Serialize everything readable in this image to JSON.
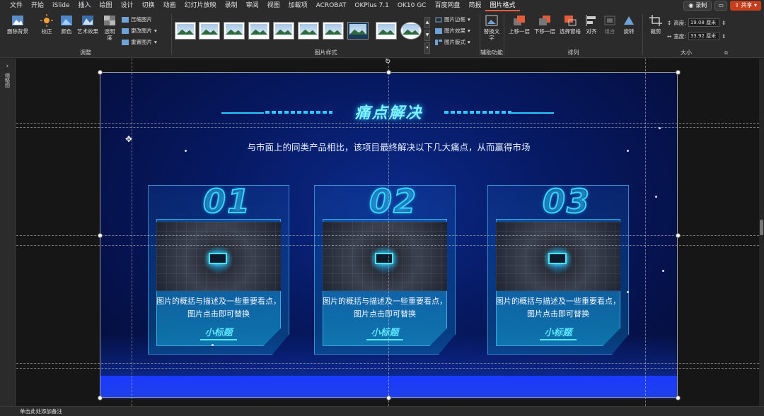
{
  "menu": {
    "items": [
      "文件",
      "开始",
      "iSlide",
      "插入",
      "绘图",
      "设计",
      "切换",
      "动画",
      "幻灯片放映",
      "录制",
      "审阅",
      "视图",
      "加载项",
      "ACROBAT",
      "OKPlus 7.1",
      "OK10 GC",
      "百度网盘",
      "简报",
      "图片格式"
    ],
    "active_index": 18,
    "record_label": "录制",
    "share_label": "共享"
  },
  "ribbon": {
    "adjust": {
      "group_label": "调整",
      "remove_bg": "删除背景",
      "correct": "校正",
      "color": "颜色",
      "art_effects": "艺术效果",
      "transparency": "透明度",
      "compress": "压缩图片",
      "change": "更改图片",
      "reset": "重置图片"
    },
    "styles": {
      "group_label": "图片样式",
      "border": "图片边框",
      "effects": "图片效果",
      "layout": "图片版式"
    },
    "accessibility": {
      "group_label": "辅助功能",
      "alt_text": "替换文字"
    },
    "arrange": {
      "group_label": "排列",
      "bring_forward": "上移一层",
      "send_backward": "下移一层",
      "selection_pane": "选择窗格",
      "align": "对齐",
      "group": "组合",
      "rotate": "旋转"
    },
    "size": {
      "group_label": "大小",
      "crop": "裁剪",
      "height_label": "高度:",
      "height_value": "19.08 厘米",
      "width_label": "宽度:",
      "width_value": "33.92 厘米"
    }
  },
  "left_pane": {
    "label": "缩略图"
  },
  "status": {
    "notes_hint": "单击此处添加备注"
  },
  "slide": {
    "title": "痛点解决",
    "subtitle": "与市面上的同类产品相比，该项目最终解决以下几大痛点，从而赢得市场",
    "cards": [
      {
        "num": "01",
        "desc": "图片的概括与描述及一些重要看点，图片点击即可替换",
        "sub": "小标题"
      },
      {
        "num": "02",
        "desc": "图片的概括与描述及一些重要看点，图片点击即可替换",
        "sub": "小标题"
      },
      {
        "num": "03",
        "desc": "图片的概括与描述及一些重要看点，图片点击即可替换",
        "sub": "小标题"
      }
    ]
  },
  "colors": {
    "accent": "#e35d3a",
    "title": "#7ff0ff",
    "cyan": "#36d6ff"
  }
}
